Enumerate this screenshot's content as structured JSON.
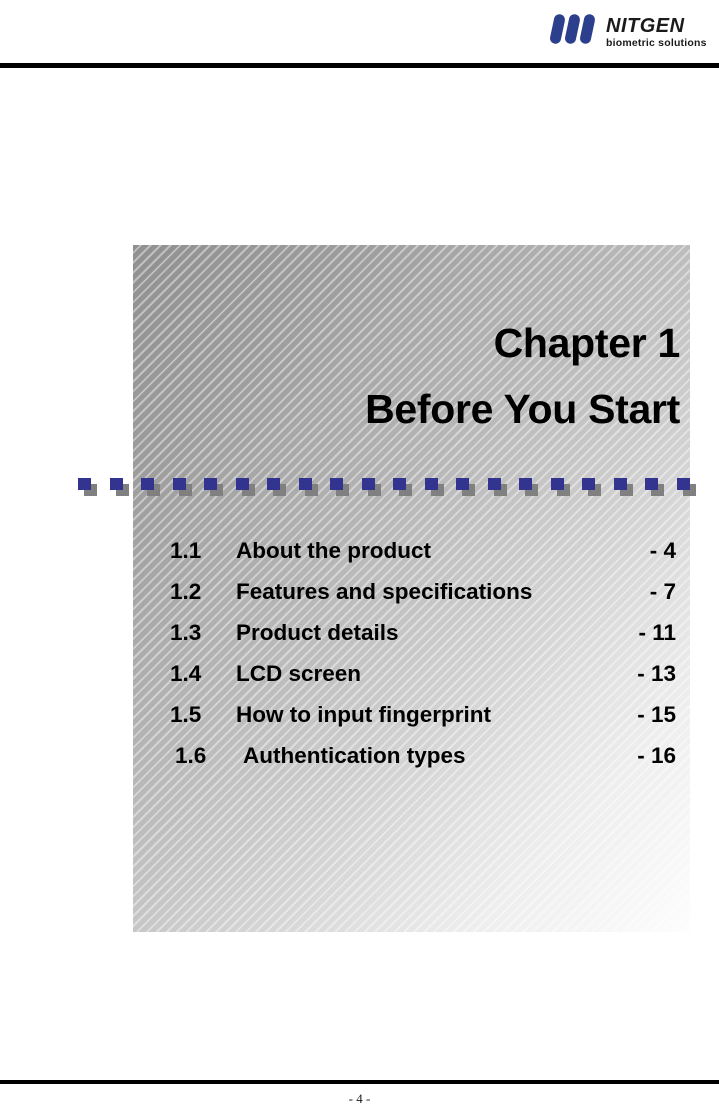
{
  "header": {
    "logo": {
      "name": "nitgen-logo",
      "wordmark": "NITGEN",
      "tagline": "biometric solutions",
      "bar_color": "#2b3f8c",
      "text_color": "#1b1b1b"
    }
  },
  "panel": {
    "title_line1": "Chapter 1",
    "title_line2": "Before You Start",
    "accent_square_color": "#333390",
    "accent_shadow_color": "#808080",
    "square_count": 20
  },
  "toc": {
    "entries": [
      {
        "number": "1.1",
        "label": "About the product",
        "page": "- 4"
      },
      {
        "number": "1.2",
        "label": "Features and specifications",
        "page": "- 7"
      },
      {
        "number": "1.3",
        "label": "Product details",
        "page": "- 11"
      },
      {
        "number": "1.4",
        "label": "LCD screen",
        "page": "- 13"
      },
      {
        "number": "1.5",
        "label": "How to input fingerprint",
        "page": "- 15"
      },
      {
        "number": "1.6",
        "label": "Authentication types",
        "page": "- 16"
      }
    ]
  },
  "footer": {
    "page_label": "- 4 -"
  }
}
